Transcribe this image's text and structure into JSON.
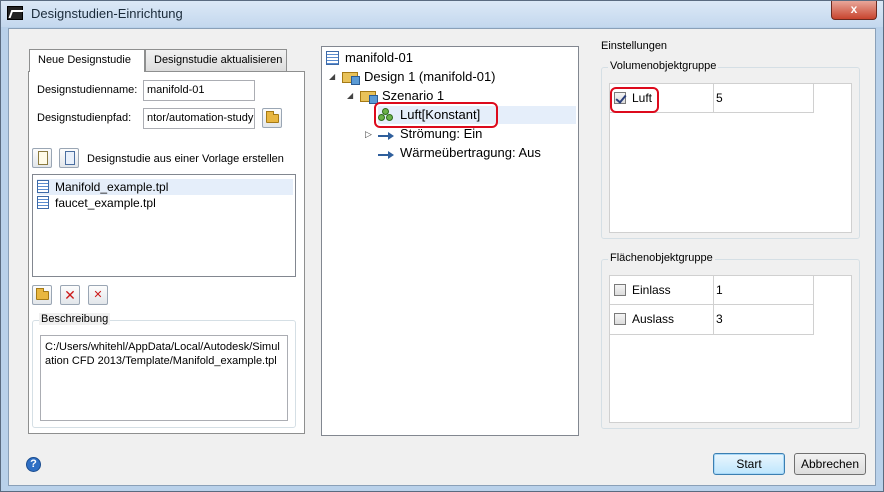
{
  "window": {
    "title": "Designstudien-Einrichtung",
    "close_symbol": "x"
  },
  "left": {
    "tabs": [
      {
        "label": "Neue Designstudie",
        "active": true
      },
      {
        "label": "Designstudie aktualisieren",
        "active": false
      }
    ],
    "name_label": "Designstudienname:",
    "name_value": "manifold-01",
    "path_label": "Designstudienpfad:",
    "path_value": "ntor/automation-study",
    "template_label": "Designstudie aus einer Vorlage erstellen",
    "templates": [
      {
        "label": "Manifold_example.tpl",
        "selected": true
      },
      {
        "label": "faucet_example.tpl",
        "selected": false
      }
    ],
    "description_title": "Beschreibung",
    "description_text": "C:/Users/whitehl/AppData/Local/Autodesk/Simul\nation CFD 2013/Template/Manifold_example.tpl"
  },
  "tree": {
    "root": "manifold-01",
    "design": "Design 1 (manifold-01)",
    "scenario": "Szenario 1",
    "material": "Luft[Konstant]",
    "flow": "Strömung: Ein",
    "heat": "Wärmeübertragung: Aus"
  },
  "settings": {
    "title": "Einstellungen",
    "volume_group": {
      "title": "Volumenobjektgruppe",
      "rows": [
        {
          "name": "Luft",
          "value": "5",
          "checked": true
        }
      ]
    },
    "surface_group": {
      "title": "Flächenobjektgruppe",
      "rows": [
        {
          "name": "Einlass",
          "value": "1",
          "checked": false
        },
        {
          "name": "Auslass",
          "value": "3",
          "checked": false
        }
      ]
    }
  },
  "footer": {
    "help_symbol": "?",
    "start_label": "Start",
    "cancel_label": "Abbrechen"
  },
  "colors": {
    "highlight_outline": "#dd0a1c",
    "selection": "#e5eefa"
  }
}
